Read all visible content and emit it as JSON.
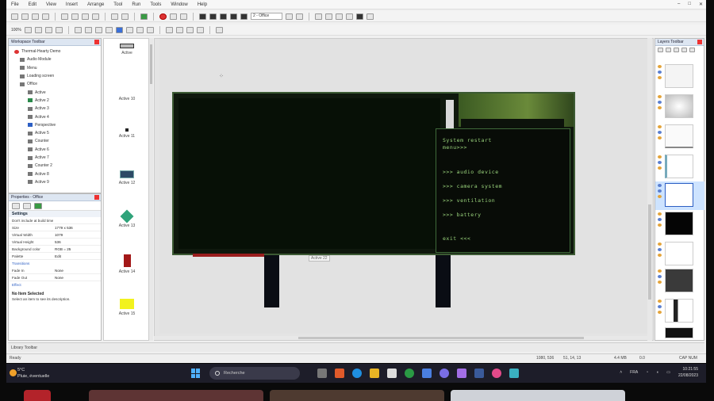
{
  "menu": {
    "items": [
      "File",
      "Edit",
      "View",
      "Insert",
      "Arrange",
      "Tool",
      "Run",
      "Tools",
      "Window",
      "Help"
    ],
    "zoom": "100%",
    "layout_select": "2 - Office"
  },
  "workspace": {
    "title": "Workspace Toolbar",
    "items": [
      {
        "label": "Thermal-Hearty Demo",
        "level": 1,
        "icon": "r"
      },
      {
        "label": "Audio Module",
        "level": 2,
        "icon": ""
      },
      {
        "label": "Menu",
        "level": 2,
        "icon": ""
      },
      {
        "label": "Loading screen",
        "level": 2,
        "icon": ""
      },
      {
        "label": "Office",
        "level": 2,
        "icon": ""
      },
      {
        "label": "Active",
        "level": 3,
        "icon": ""
      },
      {
        "label": "Active 2",
        "level": 3,
        "icon": "g"
      },
      {
        "label": "Active 3",
        "level": 3,
        "icon": ""
      },
      {
        "label": "Active 4",
        "level": 3,
        "icon": ""
      },
      {
        "label": "Perspective",
        "level": 3,
        "icon": "b"
      },
      {
        "label": "Active 5",
        "level": 3,
        "icon": ""
      },
      {
        "label": "Counter",
        "level": 3,
        "icon": ""
      },
      {
        "label": "Active 6",
        "level": 3,
        "icon": ""
      },
      {
        "label": "Active 7",
        "level": 3,
        "icon": ""
      },
      {
        "label": "Counter 2",
        "level": 3,
        "icon": ""
      },
      {
        "label": "Active 8",
        "level": 3,
        "icon": ""
      },
      {
        "label": "Active 9",
        "level": 3,
        "icon": ""
      }
    ]
  },
  "properties": {
    "title": "Properties - Office",
    "section": "Settings",
    "rows": [
      {
        "k": "Don't include at build time",
        "v": ""
      },
      {
        "k": "Size",
        "v": "1779 x 536"
      },
      {
        "k": "Virtual Width",
        "v": "1079"
      },
      {
        "k": "Virtual Height",
        "v": "536"
      },
      {
        "k": "Background color",
        "v": "RGB = 25"
      },
      {
        "k": "Palette",
        "v": "Edit"
      }
    ],
    "link": "Transitions",
    "rows2": [
      {
        "k": "Fade In",
        "v": "None"
      },
      {
        "k": "Fade Out",
        "v": "None"
      }
    ],
    "link2": "Effect",
    "desc_title": "No Item Selected",
    "desc": "Select an item to see its description."
  },
  "objects": {
    "items": [
      "Active",
      "Active 10",
      "Active 11",
      "Active 12",
      "Active 13",
      "Active 14",
      "Active 15"
    ]
  },
  "canvas": {
    "selection_label": "Active 22",
    "terminal": {
      "title": "System restart",
      "subtitle": "menu>>>",
      "options": [
        ">>> audio device",
        ">>> camera system",
        ">>> ventilation",
        ">>> battery"
      ],
      "exit": "exit <<<"
    }
  },
  "layers": {
    "title": "Layers Toolbar"
  },
  "layout_tabs": {
    "label": "Library Toolbar"
  },
  "status": {
    "ready": "Ready",
    "coords": "1080, 536",
    "pos": "51, 14, 13",
    "size": "4.4 MB",
    "num": "0.0",
    "cap": "CAP  NUM"
  },
  "taskbar": {
    "temp": "5°C",
    "weather": "Pluie, éventuelle",
    "search": "Recherche",
    "lang": "FRA",
    "time": "10:21:55",
    "date": "22/08/2023"
  },
  "colors": {
    "accent": "#2d5fc4",
    "terminal_text": "#9ad47c",
    "taskbar": "#1d1d29"
  }
}
